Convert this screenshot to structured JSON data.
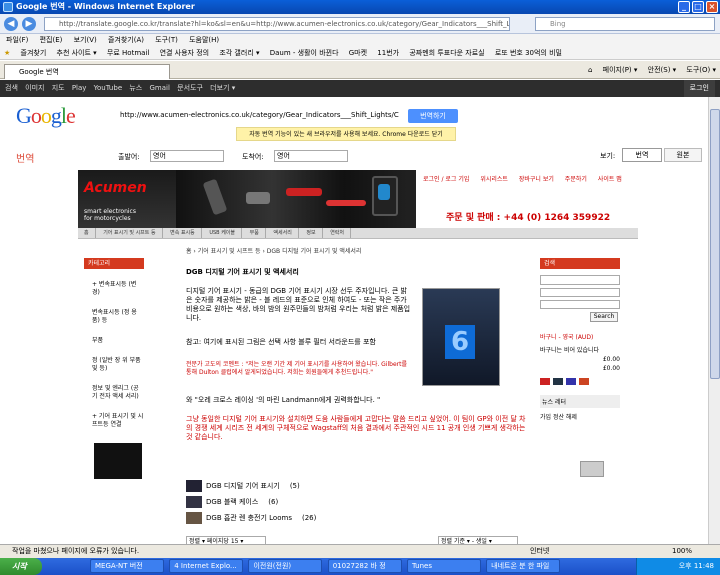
{
  "window": {
    "title": "Google 번역 - Windows Internet Explorer"
  },
  "address": {
    "url": "http://translate.google.co.kr/translate?hl=ko&sl=en&u=http://www.acumen-electronics.co.uk/category/Gear_Indicators___Shift_Lights/",
    "search_placeholder": "Bing"
  },
  "menu": [
    "파일(F)",
    "편집(E)",
    "보기(V)",
    "즐겨찾기(A)",
    "도구(T)",
    "도움말(H)"
  ],
  "favorites": [
    "즐겨찾기",
    "추천 사이트 ▾",
    "무료 Hotmail",
    "연결 사용자 정의",
    "조각 갤러리 ▾",
    "Daum - 생활이 바뀐다",
    "G마켓",
    "11번가",
    "공짜멘희 투표다운 자료실",
    "로또 번호 30억의 비밀"
  ],
  "tab": {
    "label": "Google 번역"
  },
  "tab_tools": [
    "페이지(P) ▾",
    "안전(S) ▾",
    "도구(O) ▾"
  ],
  "gbar": {
    "items": [
      "검색",
      "이미지",
      "지도",
      "Play",
      "YouTube",
      "뉴스",
      "Gmail",
      "문서도구",
      "더보기 ▾"
    ],
    "login": "로그인"
  },
  "google": {
    "logo": "Google",
    "url_text": "http://www.acumen-electronics.co.uk/category/Gear_Indicators___Shift_Lights/C",
    "translate_btn": "번역하기",
    "notice": "자동 번역 기능이 있는 새 브라우저를 사용해 보세요.  Chrome 다운로드  닫기",
    "translate_label": "번역",
    "from_label": "출발어:",
    "from_value": "영어",
    "to_label": "도착어:",
    "to_value": "영어",
    "view_label": "보기:",
    "view_trans": "번역",
    "view_orig": "원본"
  },
  "site": {
    "logo": "Acumen",
    "logo_sub1": "smart electronics",
    "logo_sub2": "for motorcycles",
    "header_links": [
      "로그인 / 로그 기입",
      "위시리스트",
      "장바구니 보기",
      "주문하기",
      "사이트 맵"
    ],
    "phone": "주문 및 판매 : +44 (0) 1264 359922",
    "subnav": [
      "홈",
      "기어 표시기 및 시프트 등",
      "변속 표시등",
      "USB 케이블",
      "부품",
      "액세서리",
      "정보",
      "연락처"
    ],
    "breadcrumb": "홈 › 기어 표시기 및 시프트 등 › DGB 디지털 기어 표시기 및 액세서리",
    "heading": "DGB 디지털 기어 표시기 및 액세서리",
    "para1": "디지털 기어 표시기 - 동급의 DGB 기어 표시기 시장 선두 주자입니다. 큰 밝은 숫자를 제공하는 밝은 - 블 레드의 표준으로 인체 하여도 - 또는 작은 주가 비용으로 원하는 색상, 바의 밤의 원주민들의 밤처럼 우리는 처럼 밝은 제품입니다.",
    "para2": "참고: 여기에 표시된 그림은 선택 사항 블루 필터 서라운드를 포함",
    "para3": "전문가 고도의 코멘트 : \"저는 오랜 기간 제 기어 표시기를 사용하여 왔습니다. Gilbert를 통해 Dulton 클럽에서 알게되었습니다. 저희는 회원들에게 추천드립니다.\"",
    "para4": "와 \"오레 크로스 레이싱 '의 마린 Landmann에게 권력화합니다. \"",
    "para5": "그냥 동일한 디지털 기어 표시기와 설치하면 도움 사람들에게 고맙다는 말씀 드리고 싶었어. 이 팀이 GP와 이전 달 차의 경쟁 세계 시리즈 전 세계의 구체적으로 Wagstaff의 처음 결과에서 주관적인 시드 11 공개 인생 기쁘게 생각하는 것 같습니다.",
    "products": [
      {
        "name": "DGB 디지털 기어 표시기",
        "count": "(5)"
      },
      {
        "name": "DGB 블랙 케이스",
        "count": "(6)"
      },
      {
        "name": "DGB 흡관 렌 충전기 Looms",
        "count": "(26)"
      }
    ],
    "bottom_left": "정렬 ▾ 페이지당 15 ▾",
    "bottom_right": "정렬 기준 ▾ - 생일 ▾",
    "left_head": "카테고리",
    "left_items": [
      "+ 변속표시등 (변경)",
      "변속표시등 (정 용 품) 등",
      "부품",
      "정 (일반 장 위 부품 및 등)",
      "정보 및 엔리그 (공기 전자 액세 서리)",
      "+ 기어 표시기 및 시 프트등 연결"
    ],
    "right_head": "검색",
    "right_btn": "Search",
    "cart_head": "바구니 - 영국 (AUD)",
    "cart_lines": [
      "바구니는 비어 있습니다",
      "£0.00",
      "£0.00"
    ],
    "news_head": "뉴스 레터",
    "news_link": "가입 정산 해제"
  },
  "status": {
    "text": "작업을 마쳤으나 페이지에 오류가 있습니다.",
    "zone": "인터넷",
    "zoom": "100%"
  },
  "taskbar": {
    "start": "시작",
    "tasks": [
      "MEGA-NT 버전",
      "4 Internet Explo...",
      "이전원(전원)",
      "01027282 바 정",
      "Tunes",
      "내네트온 분 한 파일"
    ],
    "time": "오후 11:48"
  }
}
